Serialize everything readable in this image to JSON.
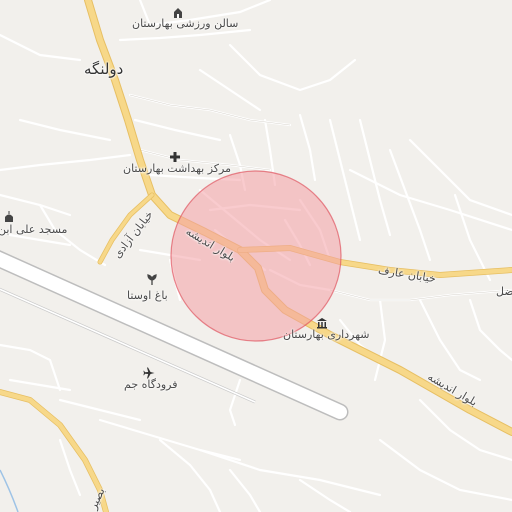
{
  "map": {
    "colors": {
      "background": "#f2f0ec",
      "minor_road": "#ffffff",
      "minor_road_casing": "#d6d2cb",
      "primary_road": "#f7d889",
      "primary_road_casing": "#e7bf63",
      "runway": "#ffffff",
      "runway_casing": "#bdbdbd",
      "water": "#9ec3e6",
      "highlight_fill": "#f4a0a6",
      "highlight_stroke": "#e05561"
    },
    "places": {
      "town": "دولنگه",
      "sports_hall": "سالن ورزشی بهارستان",
      "health_center": "مرکز بهداشت بهارستان",
      "mosque": "مسجد علی ابن",
      "garden": "باغ اوستا",
      "municipality": "شهرداری بهارستان",
      "airport": "فرودگاه جم"
    },
    "roads": {
      "azadi": "خیابان آزادی",
      "andisheh_1": "بلوار اندیشه",
      "andisheh_2": "بلوار اندیشه",
      "aref": "خیابان عارف",
      "edge_fragment": "ضل",
      "south_fragment": "بصیر"
    },
    "icons": {
      "sports_hall": "sports-hall-icon",
      "health_center": "health-center-icon",
      "mosque": "mosque-icon",
      "garden": "garden-icon",
      "municipality": "municipality-icon",
      "airport": "airport-icon"
    }
  }
}
